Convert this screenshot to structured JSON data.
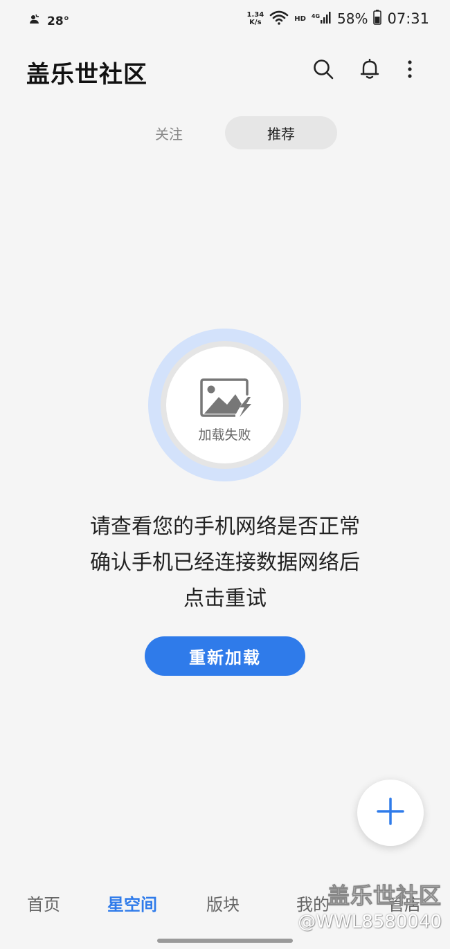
{
  "status_bar": {
    "temperature": "28°",
    "net_speed_value": "1.34",
    "net_speed_unit": "K/s",
    "hd_badge": "HD",
    "network_type": "4G",
    "battery": "58%",
    "time": "07:31"
  },
  "header": {
    "title": "盖乐世社区"
  },
  "tabs": [
    {
      "label": "关注",
      "active": false
    },
    {
      "label": "推荐",
      "active": true
    }
  ],
  "error_state": {
    "icon_label": "加载失败",
    "message_lines": [
      "请查看您的手机网络是否正常",
      "确认手机已经连接数据网络后",
      "点击重试"
    ],
    "button_label": "重新加载"
  },
  "bottom_nav": [
    {
      "label": "首页",
      "active": false
    },
    {
      "label": "星空间",
      "active": true
    },
    {
      "label": "版块",
      "active": false
    },
    {
      "label": "我的",
      "active": false
    },
    {
      "label": "管店",
      "active": false
    }
  ],
  "watermark": {
    "logo": "盖乐世社区",
    "user": "@WWL8580040"
  },
  "colors": {
    "accent": "#2f7bea",
    "background": "#f5f5f5",
    "ring": "#d3e2fb"
  }
}
